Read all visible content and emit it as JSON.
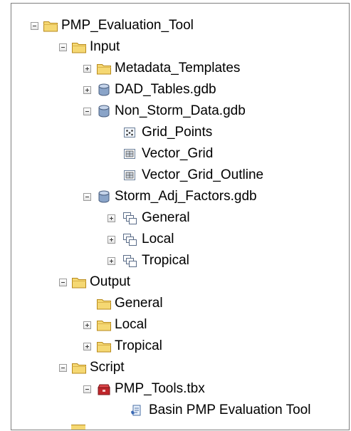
{
  "tree": {
    "root": "PMP_Evaluation_Tool",
    "input": {
      "label": "Input",
      "metadata_templates": "Metadata_Templates",
      "dad_tables": "DAD_Tables.gdb",
      "non_storm": {
        "label": "Non_Storm_Data.gdb",
        "grid_points": "Grid_Points",
        "vector_grid": "Vector_Grid",
        "vector_grid_outline": "Vector_Grid_Outline"
      },
      "storm_adj": {
        "label": "Storm_Adj_Factors.gdb",
        "general": "General",
        "local": "Local",
        "tropical": "Tropical"
      }
    },
    "output": {
      "label": "Output",
      "general": "General",
      "local": "Local",
      "tropical": "Tropical"
    },
    "script": {
      "label": "Script",
      "toolbox": "PMP_Tools.tbx",
      "tool": "Basin PMP Evaluation Tool"
    }
  },
  "icons": {
    "folder": "folder-icon",
    "geodatabase": "geodatabase-icon",
    "point_feature_class": "point-feature-class-icon",
    "polygon_feature_class": "polygon-feature-class-icon",
    "feature_dataset": "feature-dataset-icon",
    "toolbox": "toolbox-icon",
    "script_tool": "script-tool-icon"
  },
  "colors": {
    "folder_fill": "#f5d873",
    "folder_edge": "#b88a1c",
    "gdb_fill": "#8aa4c8",
    "toolbox_red": "#c0262b",
    "panel_border": "#7f7f7f"
  }
}
